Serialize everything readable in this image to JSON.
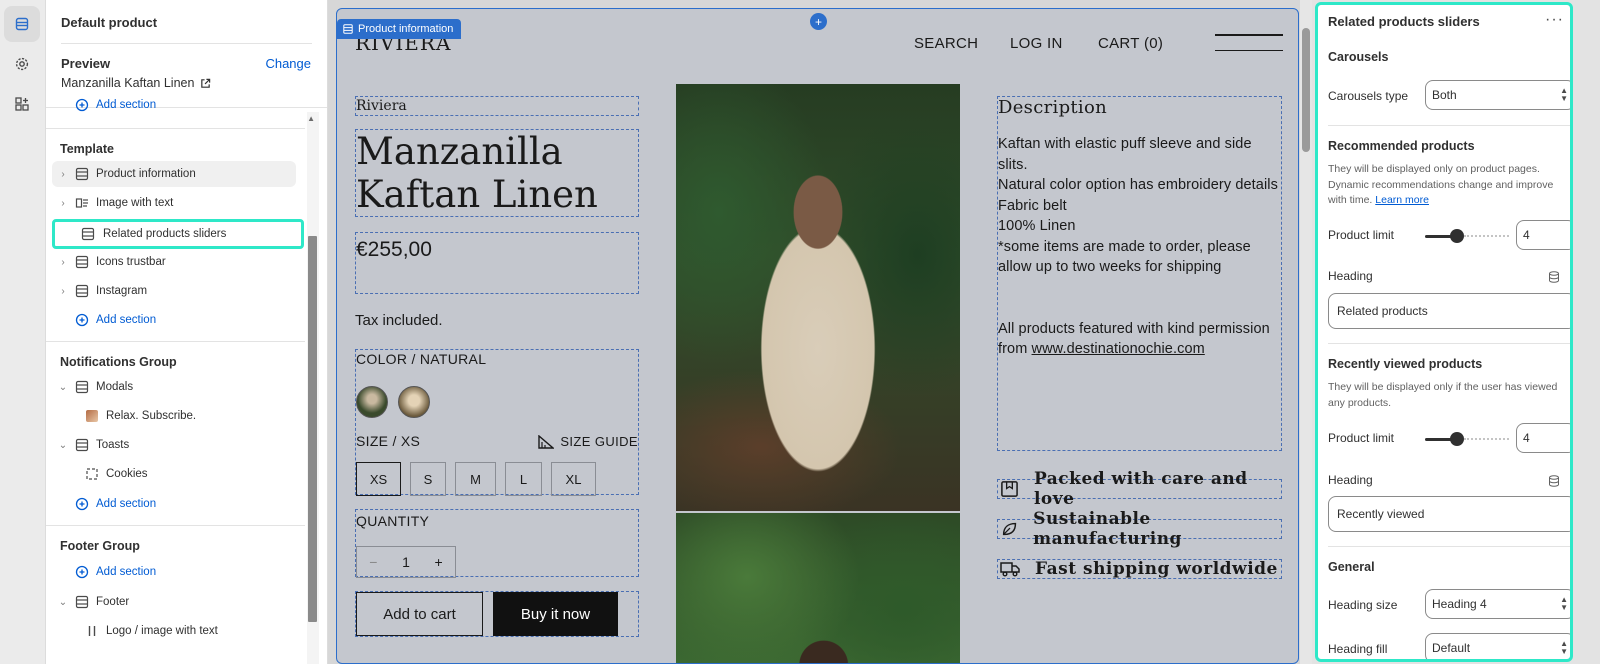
{
  "sidebar": {
    "title": "Default product",
    "preview_label": "Preview",
    "change_label": "Change",
    "preview_value": "Manzanilla Kaftan Linen",
    "add_section_top": "Add section",
    "template_heading": "Template",
    "template_items": [
      "Product information",
      "Image with text",
      "Related products sliders",
      "Icons trustbar",
      "Instagram"
    ],
    "add_section_label": "Add section",
    "notifications_heading": "Notifications Group",
    "modals_label": "Modals",
    "modal_child": "Relax. Subscribe.",
    "toasts_label": "Toasts",
    "toast_child": "Cookies",
    "footer_heading": "Footer Group",
    "footer_label": "Footer",
    "footer_child": "Logo / image with text"
  },
  "preview": {
    "section_tag": "Product information",
    "logo": "RIVIERA",
    "nav": [
      "SEARCH",
      "LOG IN",
      "CART (0)"
    ],
    "vendor": "Riviera",
    "product_title_line1": "Manzanilla",
    "product_title_line2": "Kaftan Linen",
    "price": "€255,00",
    "tax_note": "Tax included.",
    "color_label": "COLOR",
    "color_value": "NATURAL",
    "size_label": "SIZE",
    "size_value": "XS",
    "size_guide": "SIZE GUIDE",
    "sizes": [
      "XS",
      "S",
      "M",
      "L",
      "XL"
    ],
    "quantity_label": "QUANTITY",
    "quantity_minus": "−",
    "quantity_value": "1",
    "quantity_plus": "+",
    "add_to_cart": "Add to cart",
    "buy_now": "Buy it now",
    "description_heading": "Description",
    "description_lines": [
      "Kaftan with elastic puff sleeve and side slits.",
      "Natural color option has embroidery details",
      "Fabric belt",
      "100% Linen",
      "*some items are made to order, please allow up to two weeks for shipping"
    ],
    "description_credit_1": "All products featured with kind permission",
    "description_credit_2": "from ",
    "description_credit_link": "www.destinationochie.com",
    "features": [
      "Packed with care and love",
      "Sustainable manufacturing",
      "Fast shipping worldwide"
    ]
  },
  "panel": {
    "title": "Related products sliders",
    "more": "···",
    "carousels_heading": "Carousels",
    "carousels_type_label": "Carousels type",
    "carousels_type_value": "Both",
    "recommended_heading": "Recommended products",
    "recommended_help": "They will be displayed only on product pages. Dynamic recommendations change and improve with time. ",
    "learn_more": "Learn more",
    "product_limit_label": "Product limit",
    "recommended_limit": "4",
    "recommended_limit_fraction": 0.36,
    "heading_label": "Heading",
    "recommended_heading_value": "Related products",
    "recent_heading": "Recently viewed products",
    "recent_help": "They will be displayed only if the user has viewed any products.",
    "recent_limit": "4",
    "recent_limit_fraction": 0.36,
    "recent_heading_value": "Recently viewed",
    "general_heading": "General",
    "heading_size_label": "Heading size",
    "heading_size_value": "Heading 4",
    "heading_fill_label": "Heading fill",
    "heading_fill_value": "Default"
  },
  "colors": {
    "accent": "#2c6ecb",
    "highlight": "#2ee8c8",
    "link": "#005bd3"
  }
}
